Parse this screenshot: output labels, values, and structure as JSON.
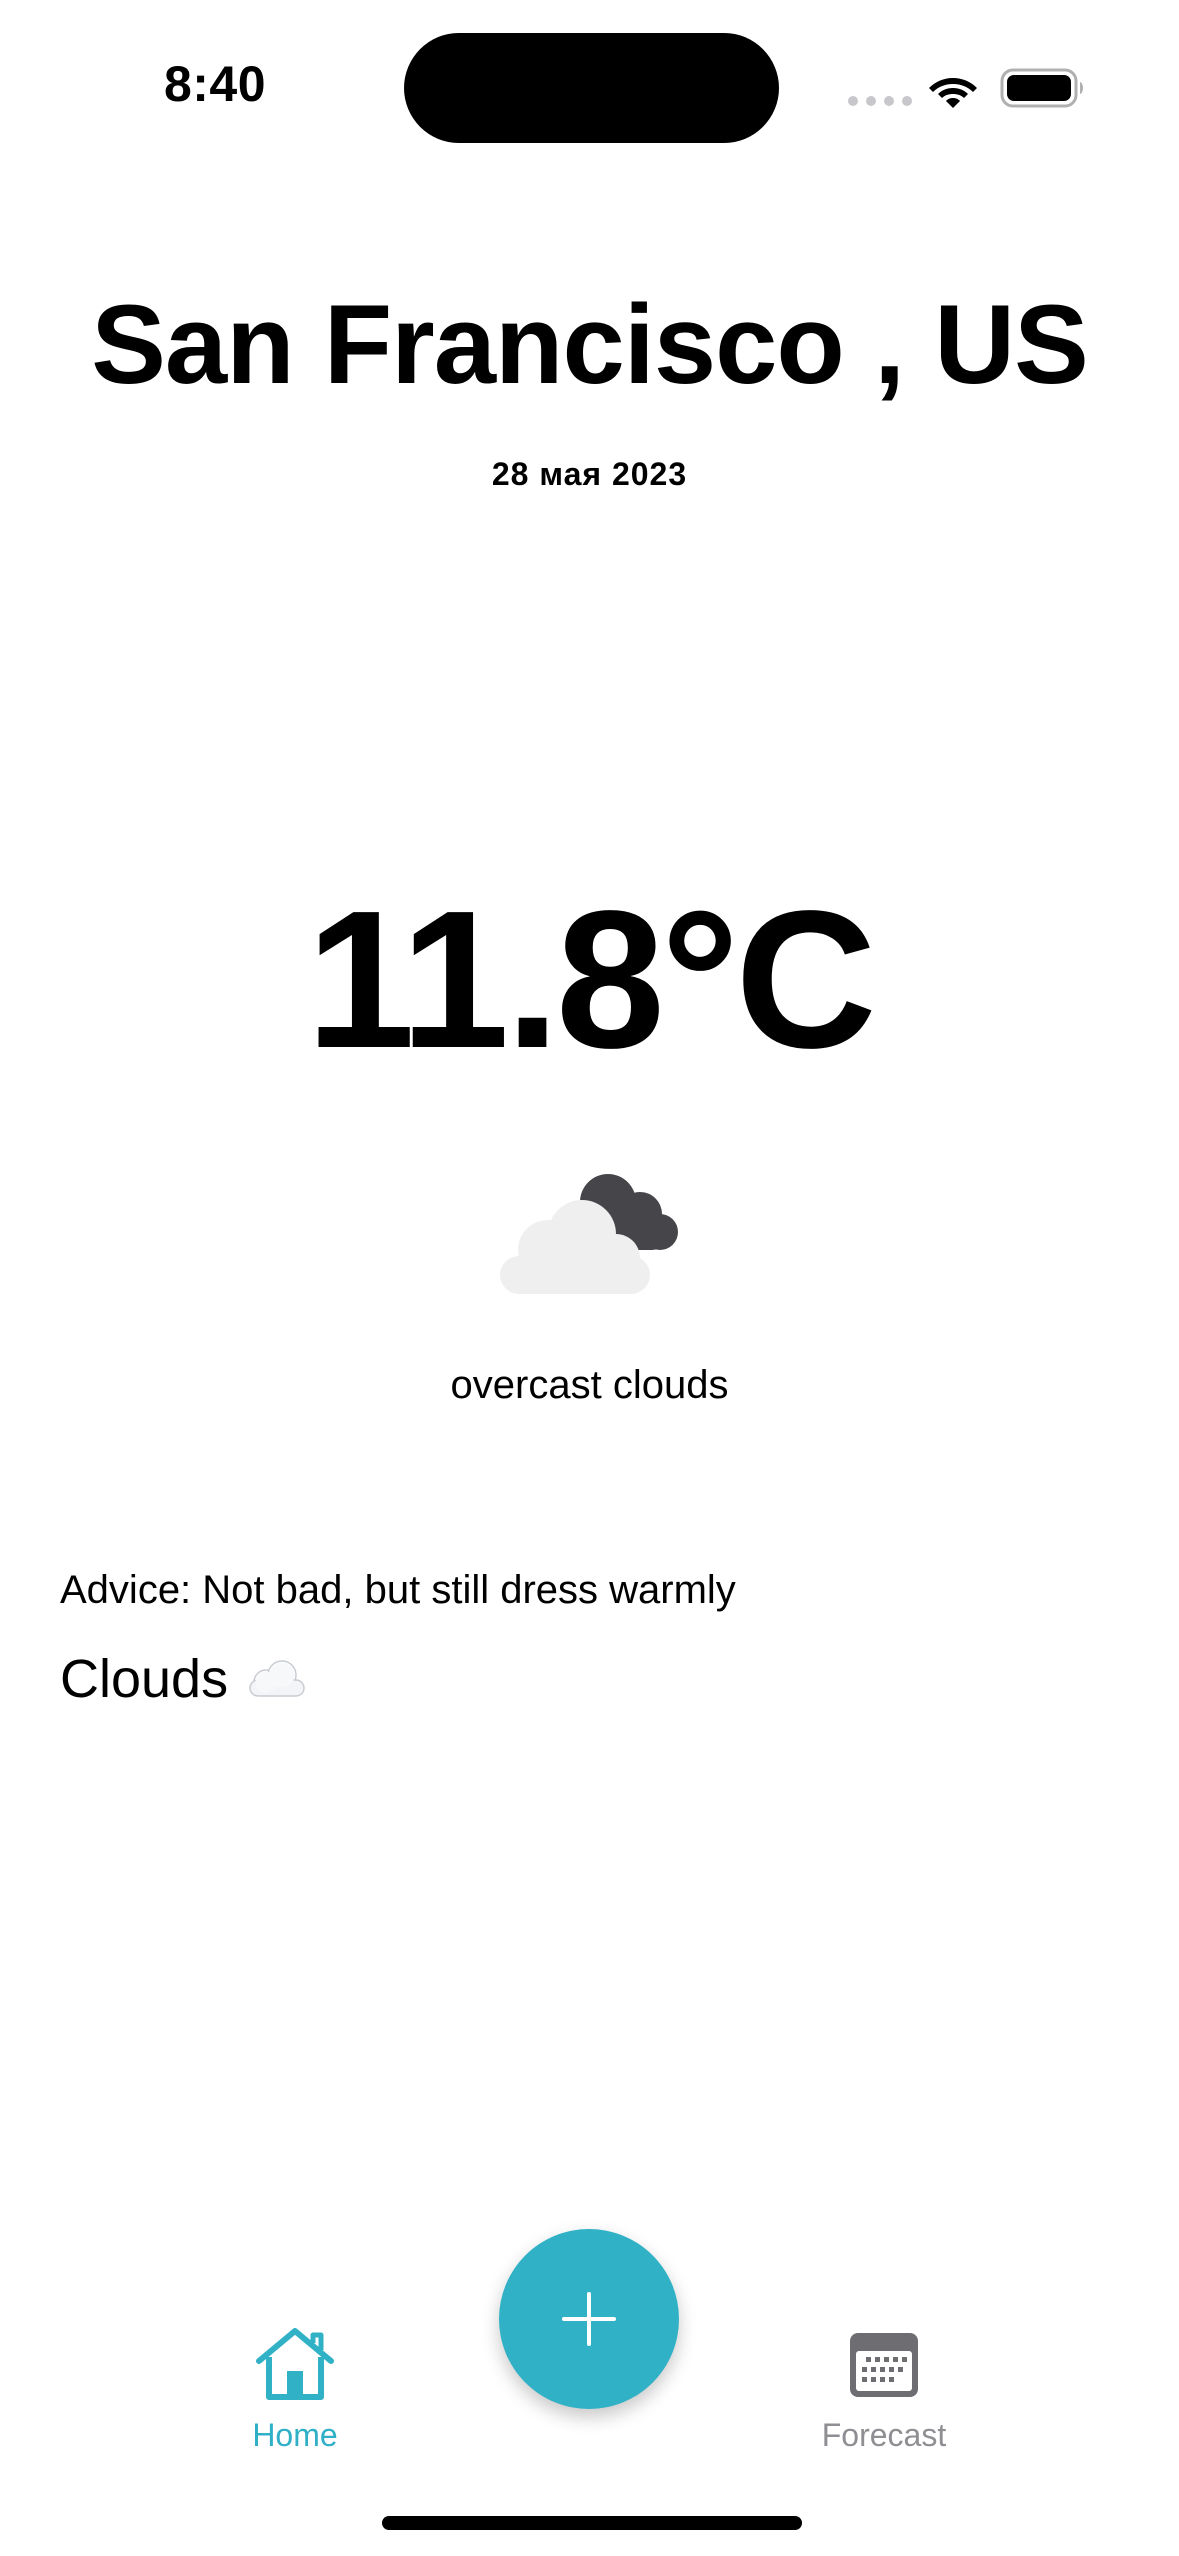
{
  "status_bar": {
    "time": "8:40",
    "signal_icon": "signal-dots-icon",
    "wifi_icon": "wifi-icon",
    "battery_icon": "battery-icon"
  },
  "header": {
    "city": "San Francisco , US",
    "date": "28 мая 2023"
  },
  "current": {
    "temperature": "11.8°C",
    "icon": "overcast-cloud-icon",
    "description": "overcast clouds"
  },
  "advice": {
    "text": "Advice: Not bad, but still dress warmly",
    "condition": "Clouds",
    "condition_icon": "cloud-icon"
  },
  "tab_bar": {
    "home_label": "Home",
    "home_icon": "house-icon",
    "forecast_label": "Forecast",
    "forecast_icon": "calendar-icon",
    "add_icon": "plus-icon",
    "active_tab": "Home"
  },
  "colors": {
    "accent": "#30b1c6",
    "inactive": "#8e8e93",
    "text": "#000000",
    "background": "#ffffff"
  }
}
